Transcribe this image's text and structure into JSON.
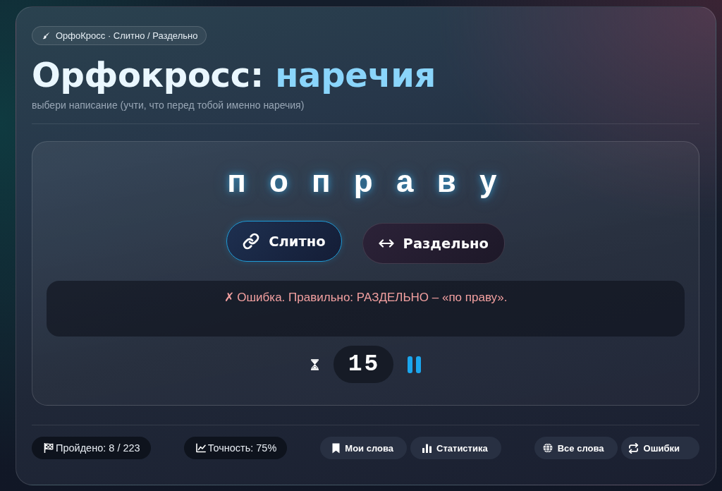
{
  "header": {
    "tag": "ОрфоКросс · Слитно / Раздельно",
    "title": "Орфокросс:",
    "title_accent": "наречия",
    "subtitle": "выбери написание (учти, что перед тобой именно наречия)"
  },
  "quiz": {
    "word": "п о п р а в у",
    "options": [
      {
        "label": "Слитно",
        "kind": "joined",
        "selected": true
      },
      {
        "label": "Раздельно",
        "kind": "separate",
        "selected": false
      }
    ],
    "feedback": {
      "kind": "error",
      "text": "✗ Ошибка. Правильно: РАЗДЕЛЬНО – «по праву»."
    },
    "timer": "15"
  },
  "footer": {
    "stats": [
      {
        "kind": "progress",
        "label": "Пройдено: 8 / 223"
      },
      {
        "kind": "accuracy",
        "label": "Точность: 75%"
      }
    ],
    "action_groups": [
      {
        "buttons": [
          {
            "kind": "my_words",
            "label": "Мои слова"
          },
          {
            "kind": "statistics",
            "label": "Статистика"
          }
        ]
      },
      {
        "buttons": [
          {
            "kind": "all_words",
            "label": "Все слова"
          },
          {
            "kind": "mistakes",
            "label": "Ошибки"
          }
        ]
      }
    ]
  }
}
